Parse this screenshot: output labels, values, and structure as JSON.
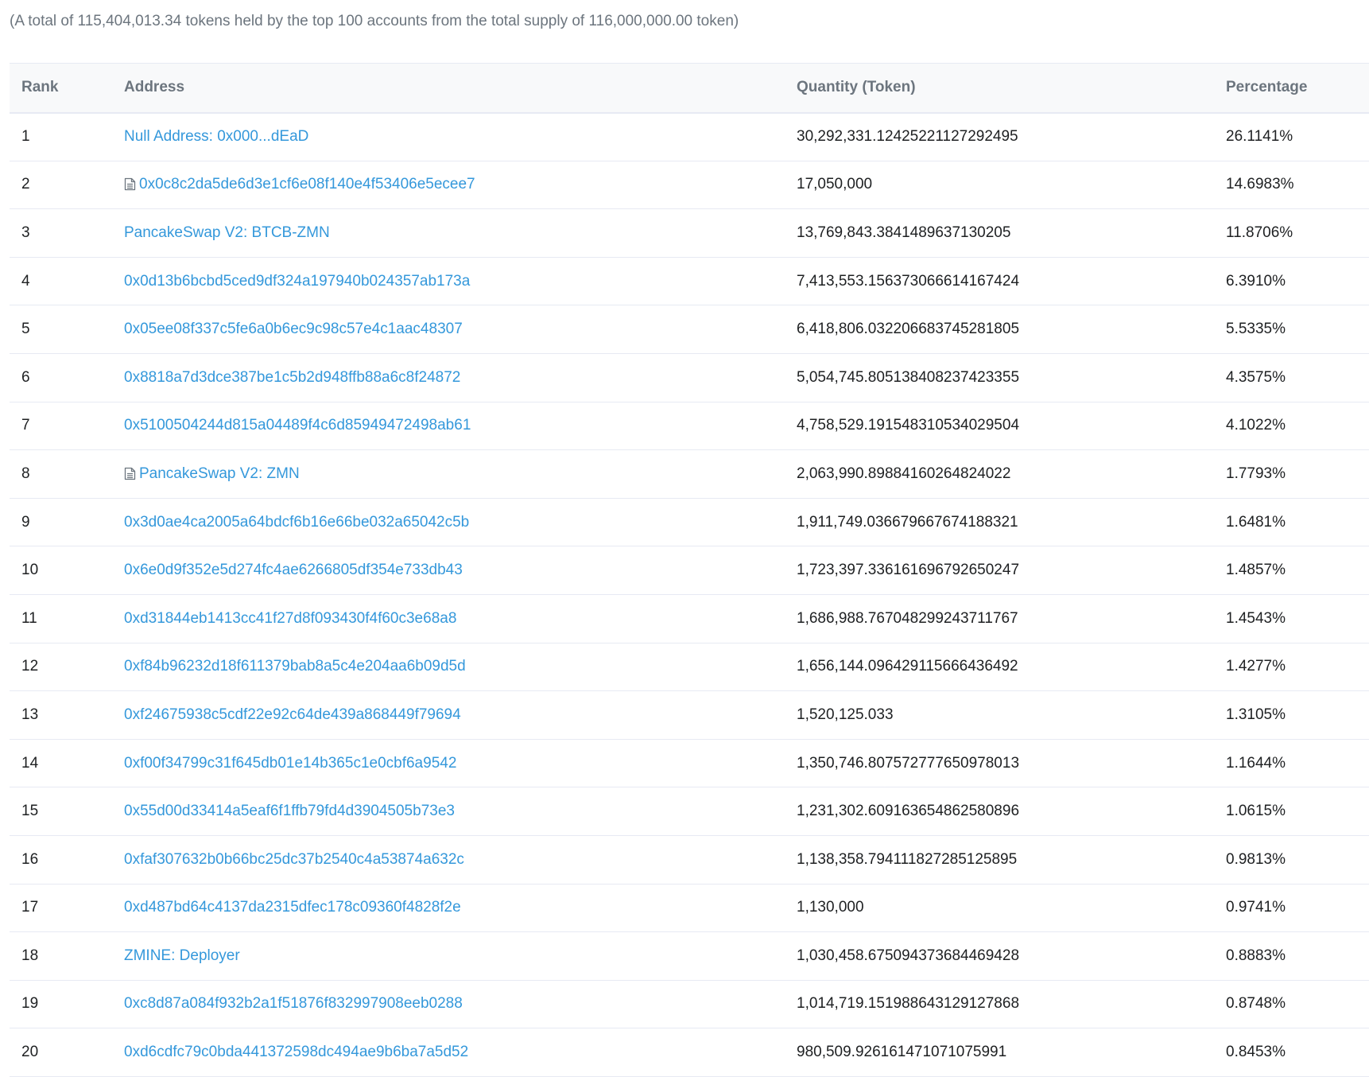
{
  "summary": "(A total of 115,404,013.34 tokens held by the top 100 accounts from the total supply of 116,000,000.00 token)",
  "table": {
    "headers": {
      "rank": "Rank",
      "address": "Address",
      "quantity": "Quantity (Token)",
      "percentage": "Percentage"
    },
    "rows": [
      {
        "rank": "1",
        "address": "Null Address: 0x000...dEaD",
        "contract": false,
        "quantity": "30,292,331.12425221127292495",
        "percentage": "26.1141%"
      },
      {
        "rank": "2",
        "address": "0x0c8c2da5de6d3e1cf6e08f140e4f53406e5ecee7",
        "contract": true,
        "quantity": "17,050,000",
        "percentage": "14.6983%"
      },
      {
        "rank": "3",
        "address": "PancakeSwap V2: BTCB-ZMN",
        "contract": false,
        "quantity": "13,769,843.3841489637130205",
        "percentage": "11.8706%"
      },
      {
        "rank": "4",
        "address": "0x0d13b6bcbd5ced9df324a197940b024357ab173a",
        "contract": false,
        "quantity": "7,413,553.156373066614167424",
        "percentage": "6.3910%"
      },
      {
        "rank": "5",
        "address": "0x05ee08f337c5fe6a0b6ec9c98c57e4c1aac48307",
        "contract": false,
        "quantity": "6,418,806.032206683745281805",
        "percentage": "5.5335%"
      },
      {
        "rank": "6",
        "address": "0x8818a7d3dce387be1c5b2d948ffb88a6c8f24872",
        "contract": false,
        "quantity": "5,054,745.805138408237423355",
        "percentage": "4.3575%"
      },
      {
        "rank": "7",
        "address": "0x5100504244d815a04489f4c6d85949472498ab61",
        "contract": false,
        "quantity": "4,758,529.191548310534029504",
        "percentage": "4.1022%"
      },
      {
        "rank": "8",
        "address": "PancakeSwap V2: ZMN",
        "contract": true,
        "quantity": "2,063,990.89884160264824022",
        "percentage": "1.7793%"
      },
      {
        "rank": "9",
        "address": "0x3d0ae4ca2005a64bdcf6b16e66be032a65042c5b",
        "contract": false,
        "quantity": "1,911,749.036679667674188321",
        "percentage": "1.6481%"
      },
      {
        "rank": "10",
        "address": "0x6e0d9f352e5d274fc4ae6266805df354e733db43",
        "contract": false,
        "quantity": "1,723,397.336161696792650247",
        "percentage": "1.4857%"
      },
      {
        "rank": "11",
        "address": "0xd31844eb1413cc41f27d8f093430f4f60c3e68a8",
        "contract": false,
        "quantity": "1,686,988.767048299243711767",
        "percentage": "1.4543%"
      },
      {
        "rank": "12",
        "address": "0xf84b96232d18f611379bab8a5c4e204aa6b09d5d",
        "contract": false,
        "quantity": "1,656,144.096429115666436492",
        "percentage": "1.4277%"
      },
      {
        "rank": "13",
        "address": "0xf24675938c5cdf22e92c64de439a868449f79694",
        "contract": false,
        "quantity": "1,520,125.033",
        "percentage": "1.3105%"
      },
      {
        "rank": "14",
        "address": "0xf00f34799c31f645db01e14b365c1e0cbf6a9542",
        "contract": false,
        "quantity": "1,350,746.807572777650978013",
        "percentage": "1.1644%"
      },
      {
        "rank": "15",
        "address": "0x55d00d33414a5eaf6f1ffb79fd4d3904505b73e3",
        "contract": false,
        "quantity": "1,231,302.609163654862580896",
        "percentage": "1.0615%"
      },
      {
        "rank": "16",
        "address": "0xfaf307632b0b66bc25dc37b2540c4a53874a632c",
        "contract": false,
        "quantity": "1,138,358.794111827285125895",
        "percentage": "0.9813%"
      },
      {
        "rank": "17",
        "address": "0xd487bd64c4137da2315dfec178c09360f4828f2e",
        "contract": false,
        "quantity": "1,130,000",
        "percentage": "0.9741%"
      },
      {
        "rank": "18",
        "address": "ZMINE: Deployer",
        "contract": false,
        "quantity": "1,030,458.675094373684469428",
        "percentage": "0.8883%"
      },
      {
        "rank": "19",
        "address": "0xc8d87a084f932b2a1f51876f832997908eeb0288",
        "contract": false,
        "quantity": "1,014,719.151988643129127868",
        "percentage": "0.8748%"
      },
      {
        "rank": "20",
        "address": "0xd6cdfc79c0bda441372598dc494ae9b6ba7a5d52",
        "contract": false,
        "quantity": "980,509.926161471071075991",
        "percentage": "0.8453%"
      }
    ]
  },
  "icons": {
    "contract": "file-text-icon"
  },
  "colors": {
    "link": "#3498db",
    "muted": "#6c757e",
    "text": "#1e2022",
    "border": "#e7eaf3"
  }
}
